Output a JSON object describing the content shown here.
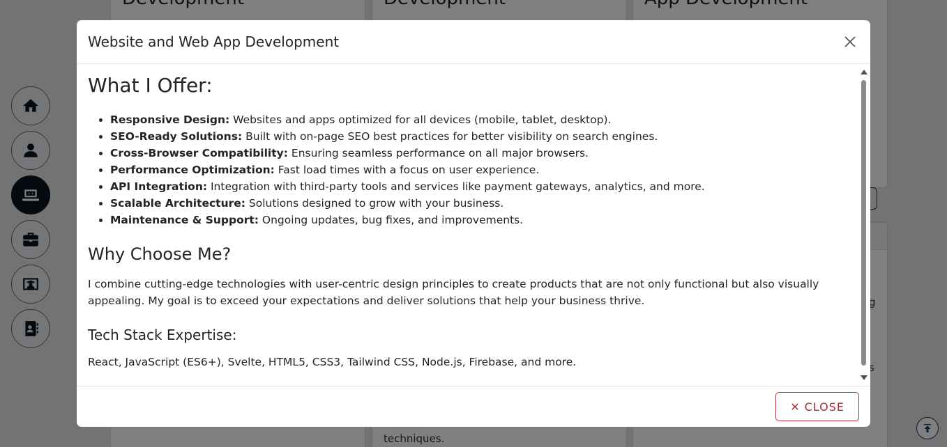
{
  "background": {
    "cards": [
      {
        "title": "Development"
      },
      {
        "title": "Development",
        "footer_text": "techniques."
      },
      {
        "title": "App Development"
      }
    ],
    "fragments": [
      {
        "text": "g"
      },
      {
        "text": "s"
      }
    ]
  },
  "sidebar": {
    "items": [
      {
        "icon": "home-icon",
        "active": false
      },
      {
        "icon": "user-icon",
        "active": false
      },
      {
        "icon": "laptop-code-icon",
        "active": true
      },
      {
        "icon": "briefcase-icon",
        "active": false
      },
      {
        "icon": "graduate-icon",
        "active": false
      },
      {
        "icon": "contact-book-icon",
        "active": false
      }
    ]
  },
  "modal": {
    "title": "Website and Web App Development",
    "offer_heading": "What I Offer:",
    "offer_items": [
      {
        "label": "Responsive Design:",
        "text": " Websites and apps optimized for all devices (mobile, tablet, desktop)."
      },
      {
        "label": "SEO-Ready Solutions:",
        "text": " Built with on-page SEO best practices for better visibility on search engines."
      },
      {
        "label": "Cross-Browser Compatibility:",
        "text": " Ensuring seamless performance on all major browsers."
      },
      {
        "label": "Performance Optimization:",
        "text": " Fast load times with a focus on user experience."
      },
      {
        "label": "API Integration:",
        "text": " Integration with third-party tools and services like payment gateways, analytics, and more."
      },
      {
        "label": "Scalable Architecture:",
        "text": " Solutions designed to grow with your business."
      },
      {
        "label": "Maintenance & Support:",
        "text": " Ongoing updates, bug fixes, and improvements."
      }
    ],
    "why_heading": "Why Choose Me?",
    "why_text": "I combine cutting-edge technologies with user-centric design principles to create products that are not only functional but also visually appealing. My goal is to exceed your expectations and deliver solutions that help your business thrive.",
    "tech_heading": "Tech Stack Expertise:",
    "tech_text": "React, JavaScript (ES6+), Svelte, HTML5, CSS3, Tailwind CSS, Node.js, Firebase, and more.",
    "close_label": "CLOSE",
    "close_glyph": "✕"
  },
  "colors": {
    "accent_danger": "#b02a37",
    "nav_active": "#0b1220",
    "backdrop": "rgba(0,0,0,0.5)"
  }
}
